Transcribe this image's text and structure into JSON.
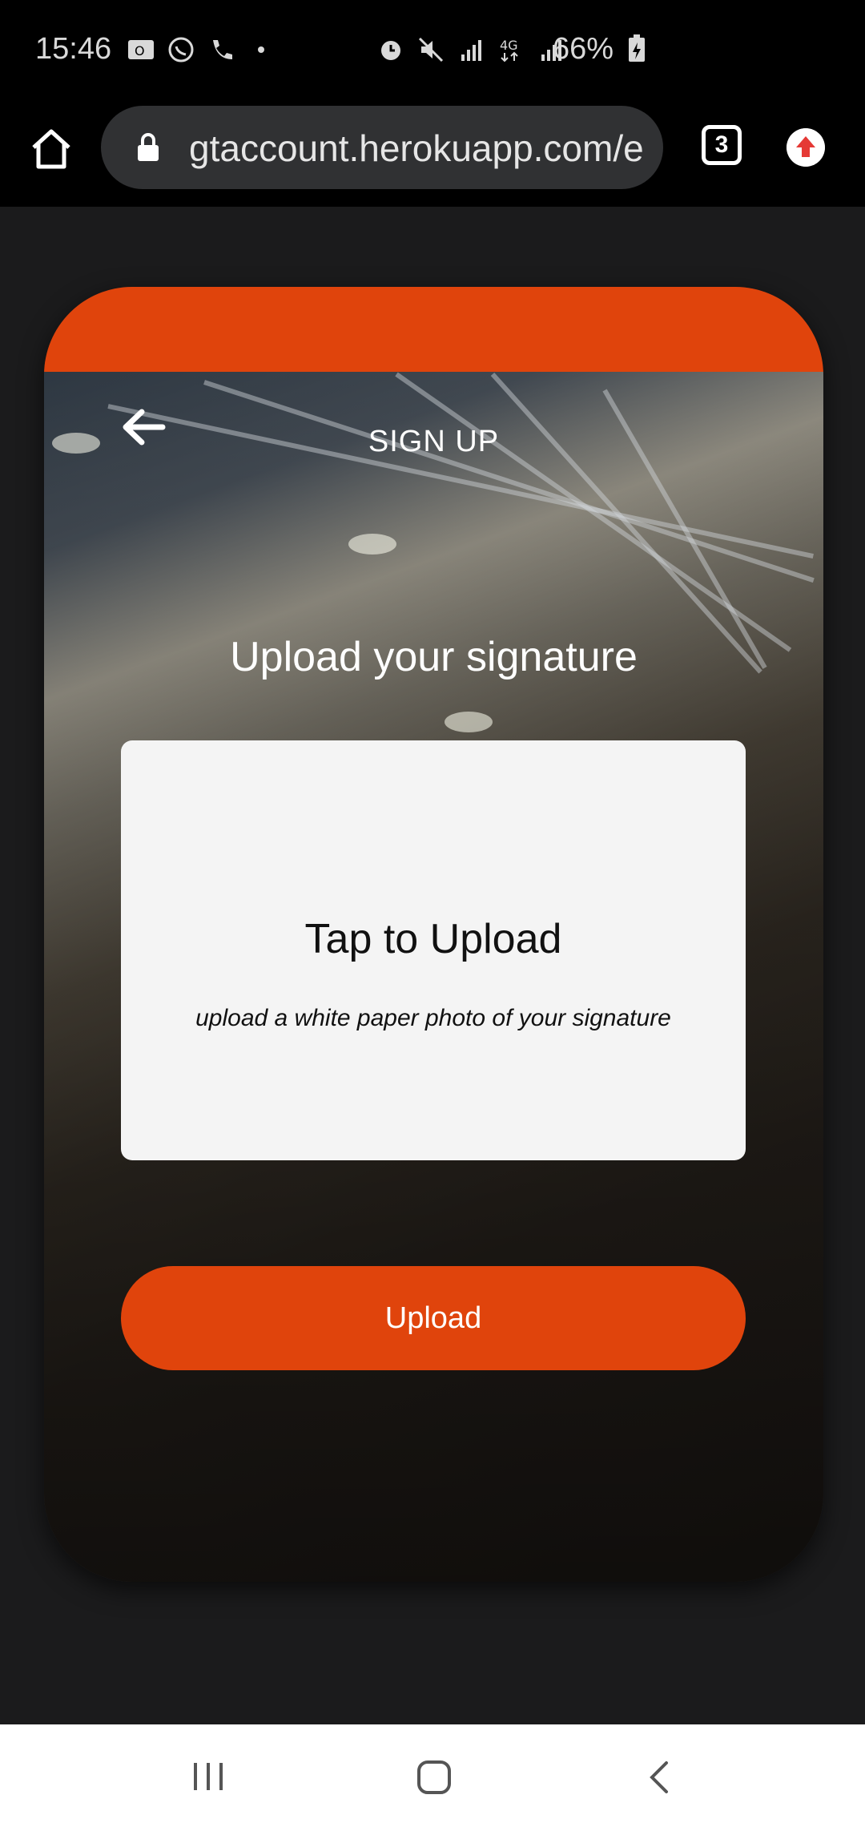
{
  "status_bar": {
    "time": "15:46",
    "battery": "66%",
    "icons_left": [
      "outlook-icon",
      "whatsapp-icon",
      "phone-icon",
      "dot-icon"
    ],
    "icons_right": [
      "alarm-icon",
      "mute-icon",
      "signal-icon",
      "4g-icon",
      "signal-icon"
    ]
  },
  "browser": {
    "url": "gtaccount.herokuapp.com/e",
    "tab_count": "3"
  },
  "page": {
    "title": "SIGN UP",
    "heading": "Upload your signature",
    "upload_box": {
      "title": "Tap to Upload",
      "subtitle": "upload a white paper photo of your signature"
    },
    "upload_button": "Upload"
  },
  "colors": {
    "accent": "#e0440c",
    "background": "#1b1b1c",
    "box": "#f4f4f4"
  }
}
